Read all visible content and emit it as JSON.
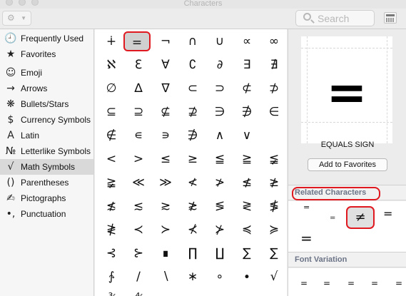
{
  "window": {
    "title": "Characters"
  },
  "toolbar": {
    "gear_icon": "gear-icon",
    "search_placeholder": "Search",
    "view_toggle_icon": "character-grid-icon"
  },
  "sidebar": {
    "selected": "Math Symbols",
    "items": [
      {
        "icon": "🕘",
        "label": "Frequently Used"
      },
      {
        "icon": "★",
        "label": "Favorites"
      },
      {
        "icon": "☺",
        "label": "Emoji"
      },
      {
        "icon": "→",
        "label": "Arrows"
      },
      {
        "icon": "❋",
        "label": "Bullets/Stars"
      },
      {
        "icon": "$",
        "label": "Currency Symbols"
      },
      {
        "icon": "A",
        "label": "Latin"
      },
      {
        "icon": "№",
        "label": "Letterlike Symbols"
      },
      {
        "icon": "√",
        "label": "Math Symbols"
      },
      {
        "icon": "()",
        "label": "Parentheses"
      },
      {
        "icon": "✍",
        "label": "Pictographs"
      },
      {
        "icon": "•,",
        "label": "Punctuation"
      }
    ]
  },
  "characters": {
    "selected": "=",
    "rows": [
      [
        "∔",
        "=",
        "¬",
        "∩",
        "∪",
        "∝",
        "∞"
      ],
      [
        "ℵ",
        "ℇ",
        "∀",
        "∁",
        "∂",
        "∃",
        "∄"
      ],
      [
        "∅",
        "∆",
        "∇",
        "⊂",
        "⊃",
        "⊄",
        "⊅"
      ],
      [
        "⊆",
        "⊇",
        "⊈",
        "⊉",
        "∋",
        "∌",
        "∈"
      ],
      [
        "∉",
        "∊",
        "∍",
        "∌",
        "∧",
        "∨",
        ""
      ],
      [
        "<",
        ">",
        "≤",
        "≥",
        "≦",
        "≧",
        "≨"
      ],
      [
        "≩",
        "≪",
        "≫",
        "≮",
        "≯",
        "≰",
        "≱"
      ],
      [
        "≴",
        "≲",
        "≳",
        "≵",
        "≶",
        "≷",
        "≸"
      ],
      [
        "≹",
        "≺",
        "≻",
        "⊀",
        "⊁",
        "≼",
        "≽"
      ],
      [
        "⊰",
        "⊱",
        "∎",
        "∏",
        "∐",
        "∑",
        "∑"
      ],
      [
        "∱",
        "∕",
        "∖",
        "∗",
        "∘",
        "∙",
        "√"
      ],
      [
        "∛",
        "∜",
        "",
        "",
        "",
        "",
        ""
      ]
    ]
  },
  "detail": {
    "glyph": "=",
    "name": "EQUALS SIGN",
    "add_favorites_label": "Add to Favorites",
    "related_title": "Related Characters",
    "related_chars": [
      "=",
      "=",
      "≠",
      "=",
      "="
    ],
    "font_variation_title": "Font Variation",
    "font_variations": [
      "=",
      "=",
      "=",
      "=",
      "="
    ]
  }
}
